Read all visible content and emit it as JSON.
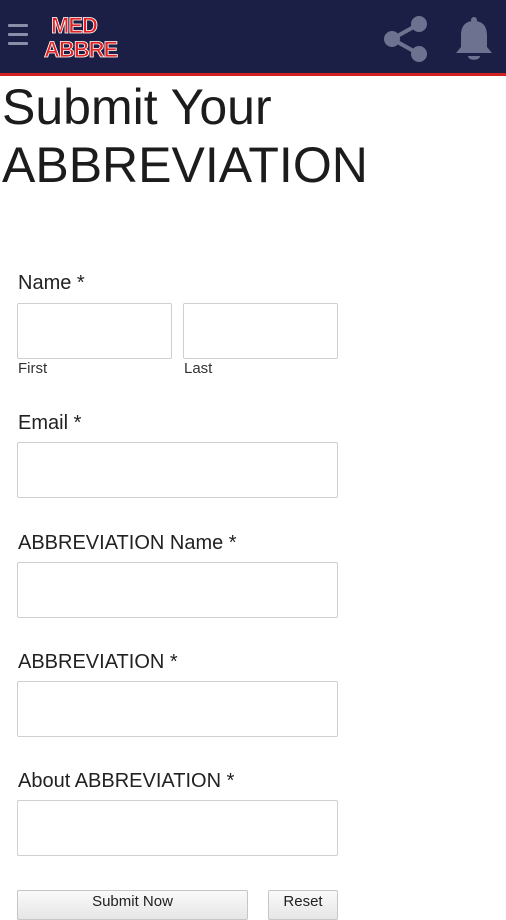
{
  "appbar": {
    "logo_line1": "MED",
    "logo_line2": "ABBRE",
    "menu_icon": "hamburger-menu-icon",
    "share_icon": "share-icon",
    "bell_icon": "bell-icon"
  },
  "page": {
    "title_line1": "Submit Your",
    "title_line2": "ABBREVIATION"
  },
  "form": {
    "name_label": "Name *",
    "first_label": "First",
    "last_label": "Last",
    "email_label": "Email *",
    "abbr_name_label": "ABBREVIATION Name *",
    "abbr_label": "ABBREVIATION *",
    "about_label": "About ABBREVIATION *",
    "submit_label": "Submit Now",
    "reset_label": "Reset"
  },
  "colors": {
    "appbar_bg": "#1b1f45",
    "appbar_accent": "#d32020",
    "logo_red": "#e12222",
    "icon_gray": "#8a8ea8"
  }
}
